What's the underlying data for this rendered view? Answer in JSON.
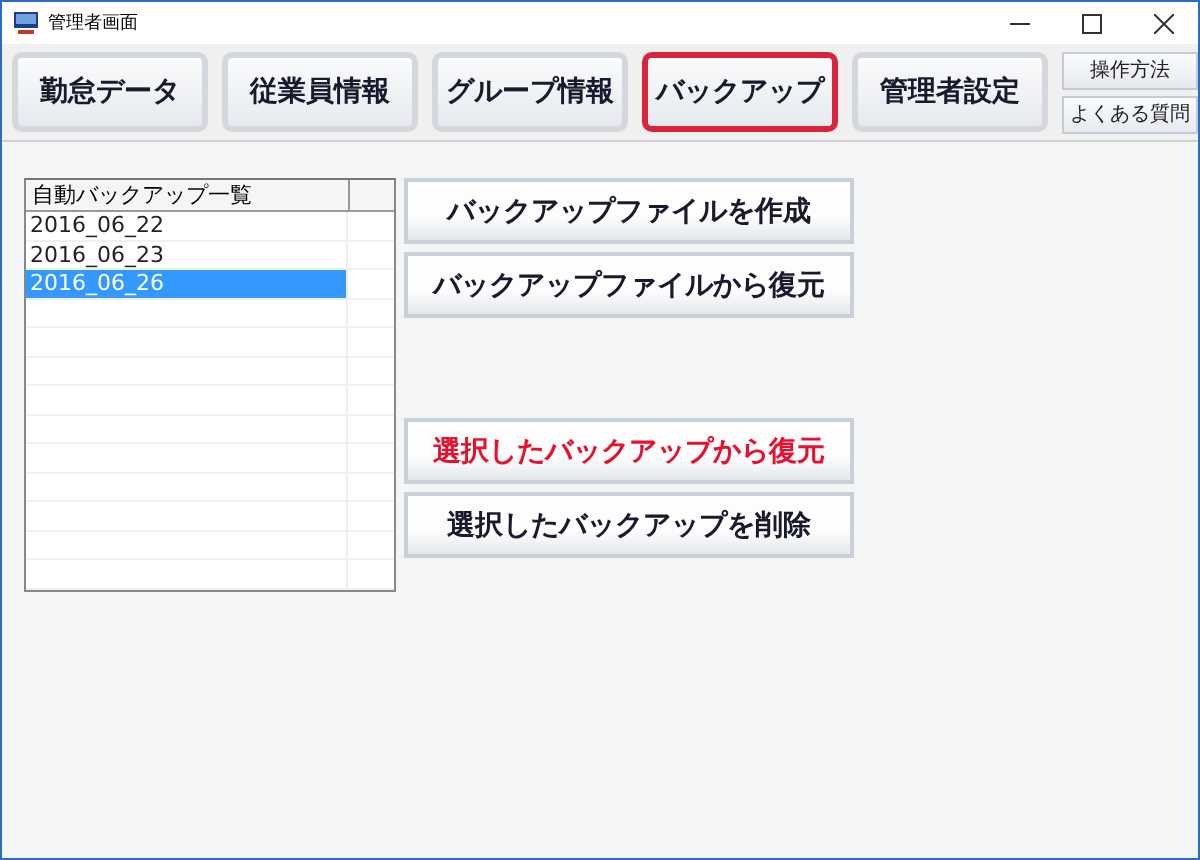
{
  "window": {
    "title": "管理者画面"
  },
  "tabs": [
    {
      "label": "勤怠データ",
      "selected": false
    },
    {
      "label": "従業員情報",
      "selected": false
    },
    {
      "label": "グループ情報",
      "selected": false
    },
    {
      "label": "バックアップ",
      "selected": true
    },
    {
      "label": "管理者設定",
      "selected": false
    }
  ],
  "help_buttons": [
    "操作方法",
    "よくある質問"
  ],
  "backup_list": {
    "columns": [
      "自動バックアップ一覧"
    ],
    "rows": [
      {
        "name": "2016_06_22",
        "selected": false
      },
      {
        "name": "2016_06_23",
        "selected": false
      },
      {
        "name": "2016_06_26",
        "selected": true
      }
    ]
  },
  "actions": [
    {
      "label": "バックアップファイルを作成",
      "kind": "normal"
    },
    {
      "label": "バックアップファイルから復元",
      "kind": "normal"
    },
    {
      "label": "選択したバックアップから復元",
      "kind": "danger"
    },
    {
      "label": "選択したバックアップを削除",
      "kind": "normal"
    }
  ]
}
